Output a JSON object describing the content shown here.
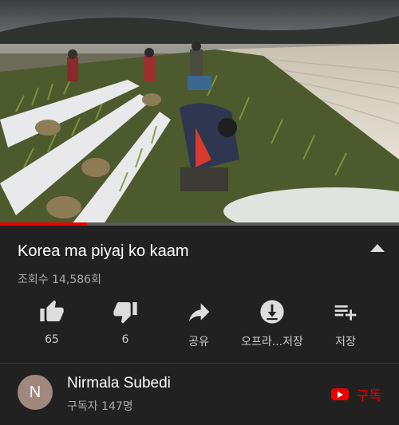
{
  "video": {
    "progress_fraction": 0.218
  },
  "title": "Korea ma piyaj ko kaam",
  "views": "조회수 14,586회",
  "actions": {
    "like": "65",
    "dislike": "6",
    "share": "공유",
    "offline": "오프라...저장",
    "save": "저장"
  },
  "channel": {
    "avatar_letter": "N",
    "name": "Nirmala Subedi",
    "subscribers": "구독자 147명",
    "subscribe_label": "구독"
  },
  "colors": {
    "background": "#212121",
    "accent": "#ee0000"
  }
}
